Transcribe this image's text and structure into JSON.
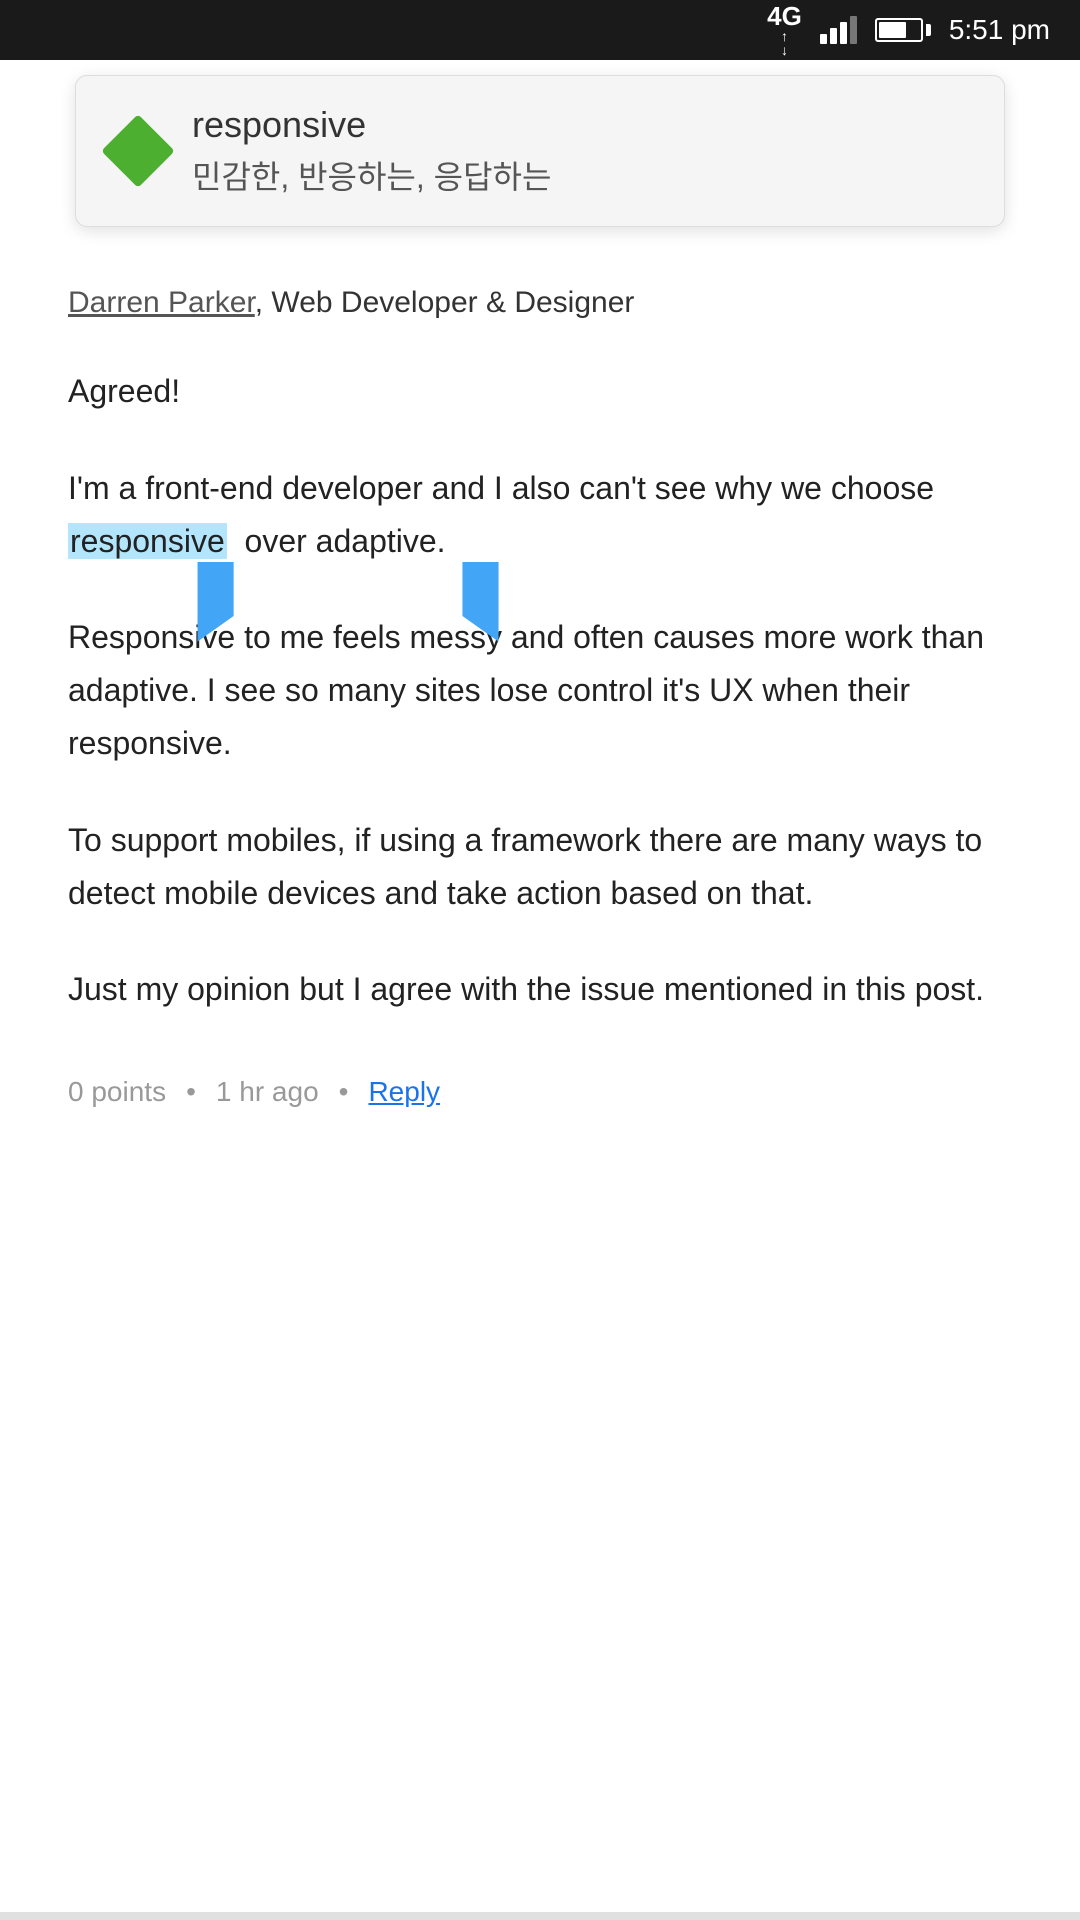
{
  "statusBar": {
    "network": "4G",
    "battery": "67%",
    "time": "5:51 pm",
    "signalBars": 3
  },
  "definitionPopup": {
    "word": "responsive",
    "translation": "민감한, 반응하는, 응답하는",
    "iconColor": "#4caf30"
  },
  "post": {
    "authorName": "Darren Parker",
    "authorTitle": ", Web Developer & Designer",
    "paragraphs": [
      "Agreed!",
      "I'm a front-end developer and I also can't see why we choose responsive over adaptive.",
      "Responsive to me feels messy and often causes more work than adaptive. I see so many sites lose control it's UX when their responsive.",
      "To support mobiles, if using a framework there are many ways to detect mobile devices and take action based on that.",
      "Just my opinion but I agree with the issue mentioned in this post."
    ],
    "highlightedWord": "responsive",
    "points": "0 points",
    "timeAgo": "1 hr ago",
    "replyLabel": "Reply"
  }
}
